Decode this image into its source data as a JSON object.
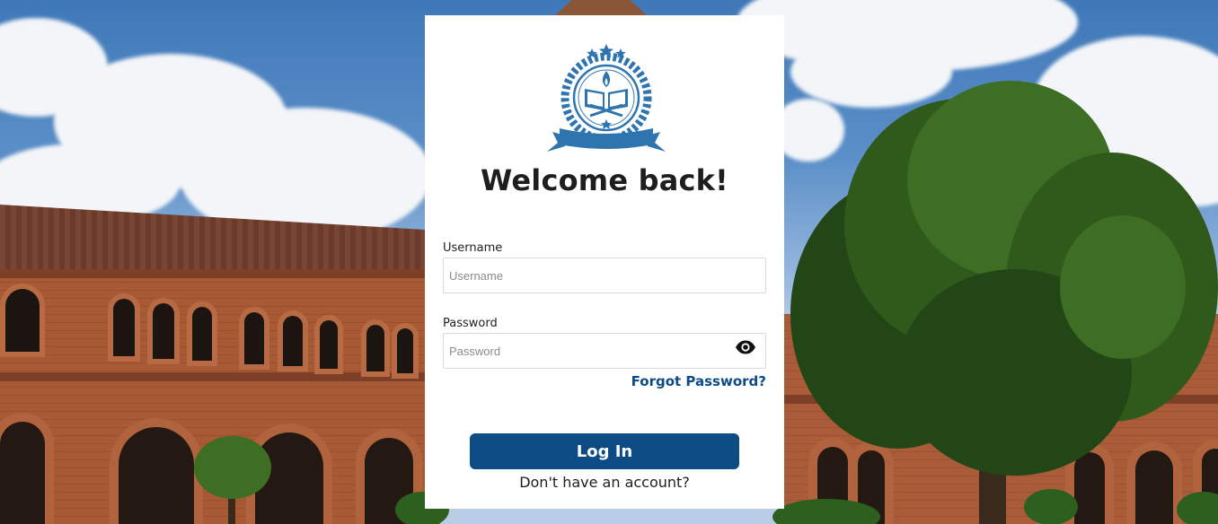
{
  "title": "Welcome back!",
  "username": {
    "label": "Username",
    "placeholder": "Username",
    "value": ""
  },
  "password": {
    "label": "Password",
    "placeholder": "Password",
    "value": "",
    "toggle_icon": "eye-icon"
  },
  "forgot_password": "Forgot Password?",
  "login_button": "Log In",
  "signup_link": "Don't have an account?",
  "logo_icon": "school-crest-logo",
  "colors": {
    "primary": "#0d4b85",
    "logo_blue": "#2e75b0",
    "title": "#1e1e1e",
    "card_bg": "#ffffff"
  }
}
